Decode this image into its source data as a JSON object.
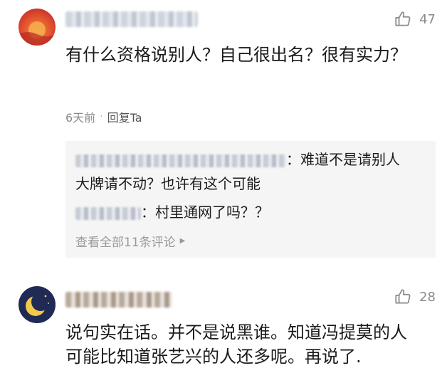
{
  "comments": [
    {
      "likes": "47",
      "text": "有什么资格说别人？自己很出名？很有实力？",
      "time": "6天前",
      "separator": "·",
      "reply_label": "回复Ta",
      "replies": [
        {
          "text": "：难道不是请别人"
        },
        {
          "text": "大牌请不动？也许有这个可能"
        },
        {
          "text": "：村里通网了吗？？"
        }
      ],
      "view_all": "查看全部11条评论",
      "avatar_colors": [
        "#f08a3c",
        "#e4572e",
        "#c9302c"
      ]
    },
    {
      "likes": "28",
      "text": "说句实在话。并不是说黑谁。知道冯提莫的人可能比知道张艺兴的人还多呢。再说了.",
      "avatar_colors": [
        "#1f2a55",
        "#f3c84b"
      ]
    }
  ],
  "icons": {
    "like": "thumbs-up-outline-icon",
    "arrow": "triangle-right-icon",
    "moon": "crescent-moon-icon"
  },
  "colors": {
    "muted_text": "#8a8a8a",
    "reply_bg": "#f5f5f5",
    "primary_text": "#1a1a1a"
  }
}
